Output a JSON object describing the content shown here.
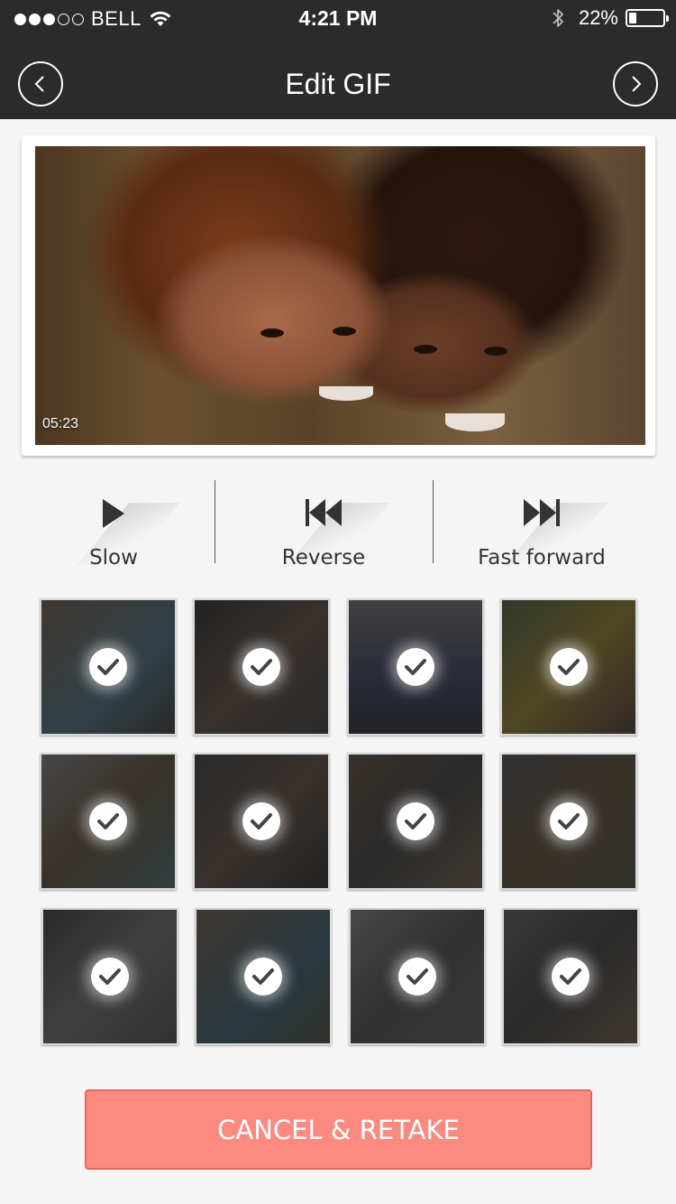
{
  "status_bar": {
    "carrier": "BELL",
    "time": "4:21 PM",
    "battery_percent": "22%",
    "battery_level": 0.22,
    "signal_bars_filled": 3,
    "signal_bars_total": 5
  },
  "nav": {
    "title": "Edit GIF",
    "back_icon": "chevron-left-icon",
    "next_icon": "chevron-right-icon"
  },
  "preview": {
    "duration": "05:23"
  },
  "controls": {
    "slow": {
      "label": "Slow",
      "icon": "play-icon"
    },
    "reverse": {
      "label": "Reverse",
      "icon": "rewind-icon"
    },
    "fast_forward": {
      "label": "Fast forward",
      "icon": "fast-forward-icon"
    }
  },
  "frames": {
    "count": 12,
    "selected_icon": "checkmark-icon",
    "all_selected": true
  },
  "actions": {
    "cancel_retake": "CANCEL & RETAKE"
  },
  "colors": {
    "header_bg": "#2b2b2b",
    "page_bg": "#f5f5f5",
    "cancel_button": "#fc8a80"
  }
}
